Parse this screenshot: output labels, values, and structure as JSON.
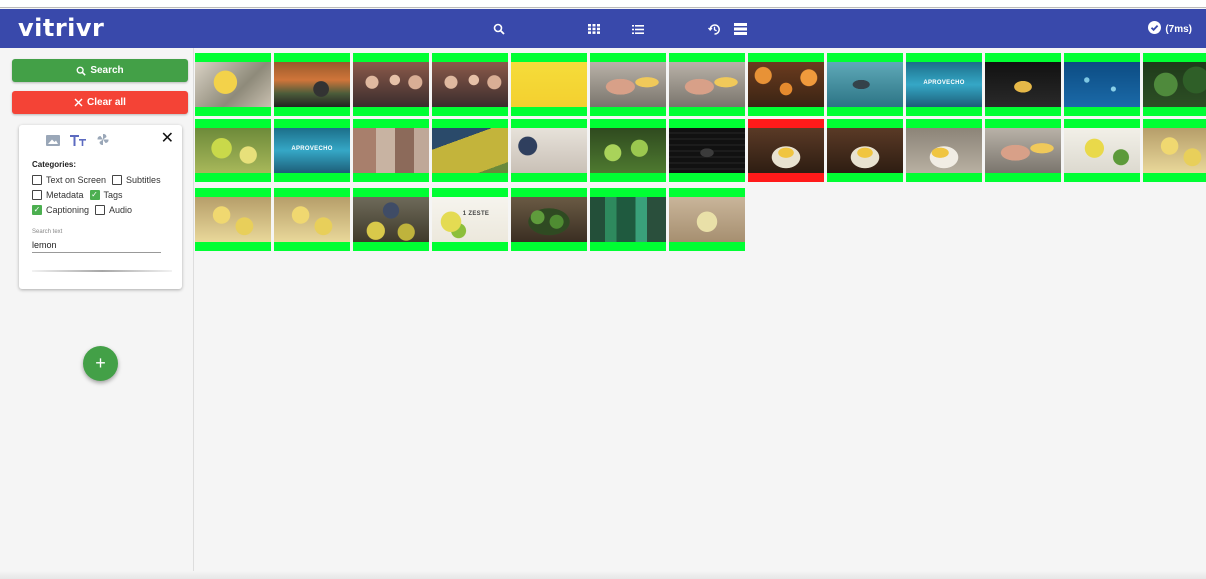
{
  "app": {
    "title": "vitrivr"
  },
  "toolbar": {
    "icons": [
      "search-icon",
      "grid-view-icon",
      "list-view-icon",
      "history-icon",
      "collections-icon"
    ],
    "status": "(7ms)",
    "status_icon": "check-circle-icon"
  },
  "sidebar": {
    "search_label": "Search",
    "clear_label": "Clear all",
    "card": {
      "mode_icons": [
        "image-icon",
        "text-icon",
        "motion-icon"
      ],
      "categories_label": "Categories:",
      "checkboxes": [
        {
          "label": "Text on Screen",
          "checked": false
        },
        {
          "label": "Subtitles",
          "checked": false
        },
        {
          "label": "Metadata",
          "checked": false
        },
        {
          "label": "Tags",
          "checked": true
        },
        {
          "label": "Captioning",
          "checked": true
        },
        {
          "label": "Audio",
          "checked": false
        }
      ],
      "search_text_label": "Search text",
      "search_text_value": "lemon"
    },
    "add_label": "+"
  },
  "colors": {
    "toolbar": "#3949ab",
    "search_button": "#43a047",
    "clear_button": "#f44336",
    "match_high": "#00ff33",
    "match_low": "#ff1a1a"
  },
  "results": [
    {
      "scene": "lemon-squeezer",
      "score_color": "#00ff33"
    },
    {
      "scene": "market-stall-logo",
      "score_color": "#00ff33"
    },
    {
      "scene": "people-group",
      "score_color": "#00ff33"
    },
    {
      "scene": "people-group",
      "score_color": "#00ff33"
    },
    {
      "scene": "yellow-screen",
      "score_color": "#00ff33"
    },
    {
      "scene": "hand-cutting-lemon",
      "score_color": "#00ff33"
    },
    {
      "scene": "hand-cutting-lemon",
      "score_color": "#00ff33"
    },
    {
      "scene": "oranges-pile",
      "score_color": "#00ff33"
    },
    {
      "scene": "underwater-shark",
      "score_color": "#00ff33"
    },
    {
      "scene": "aprovecho-title",
      "score_color": "#00ff33",
      "caption": "APROVECHO"
    },
    {
      "scene": "dark-lemon-cut",
      "score_color": "#00ff33"
    },
    {
      "scene": "underwater-fish",
      "score_color": "#00ff33"
    },
    {
      "scene": "green-leaves",
      "score_color": "#00ff33"
    },
    {
      "scene": "lemon-glass",
      "score_color": "#00ff33"
    },
    {
      "scene": "aprovecho-title",
      "score_color": "#00ff33",
      "caption": "APROVECHO"
    },
    {
      "scene": "collage-board",
      "score_color": "#00ff33"
    },
    {
      "scene": "yellow-liquid",
      "score_color": "#00ff33"
    },
    {
      "scene": "person-kitchen",
      "score_color": "#00ff33"
    },
    {
      "scene": "limes-tree",
      "score_color": "#00ff33"
    },
    {
      "scene": "dark-text-slide",
      "score_color": "#00ff33"
    },
    {
      "scene": "lemon-plate",
      "score_color": "#ff1a1a"
    },
    {
      "scene": "lemon-plate",
      "score_color": "#00ff33"
    },
    {
      "scene": "lemon-plate-light",
      "score_color": "#00ff33"
    },
    {
      "scene": "hand-cutting-lemon",
      "score_color": "#00ff33"
    },
    {
      "scene": "lemon-sprig",
      "score_color": "#00ff33"
    },
    {
      "scene": "lemon-slices-glass",
      "score_color": "#00ff33"
    },
    {
      "scene": "lemon-slices-glass",
      "score_color": "#00ff33"
    },
    {
      "scene": "lemon-slices-glass",
      "score_color": "#00ff33"
    },
    {
      "scene": "market-vendor",
      "score_color": "#00ff33"
    },
    {
      "scene": "zeste-title",
      "score_color": "#00ff33",
      "caption": "1 ZESTE"
    },
    {
      "scene": "limes-bowl",
      "score_color": "#00ff33"
    },
    {
      "scene": "green-bottles",
      "score_color": "#00ff33"
    },
    {
      "scene": "lemonade-glass",
      "score_color": "#00ff33"
    }
  ]
}
